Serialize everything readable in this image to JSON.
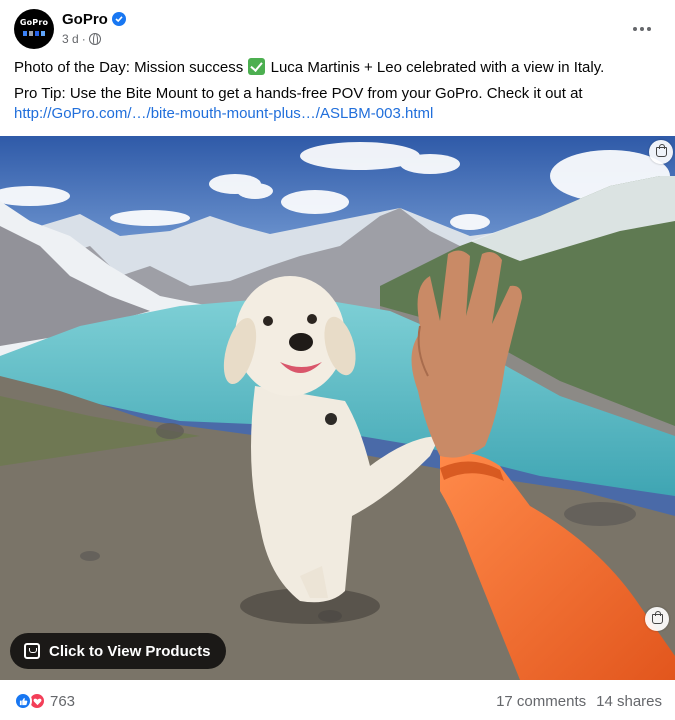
{
  "post": {
    "page_name": "GoPro",
    "avatar_text": "GoPro",
    "time": "3 d",
    "separator": "·",
    "caption_line1_before": "Photo of the Day: Mission success",
    "caption_line1_after": "Luca Martinis + Leo celebrated with a view in Italy.",
    "caption_line2": "Pro Tip: Use the Bite Mount to get a hands-free POV from your GoPro. Check it out at",
    "caption_link": "http://GoPro.com/…/bite-mouth-mount-plus…/ASLBM-003.html"
  },
  "photo": {
    "view_products_label": "Click to View Products"
  },
  "footer": {
    "reaction_count": "763",
    "comments": "17 comments",
    "shares": "14 shares"
  },
  "icons": [
    "verified-icon",
    "globe-icon",
    "more-icon",
    "check-icon",
    "shop-icon",
    "view-products-icon",
    "like-icon",
    "love-icon"
  ],
  "colors": {
    "link": "#216fdb",
    "verified": "#1877f2",
    "like": "#1877f2",
    "love": "#f33e58",
    "secondary_text": "#65676b",
    "sleeve": "#f36b2c",
    "lake": "#5fbcc6"
  }
}
